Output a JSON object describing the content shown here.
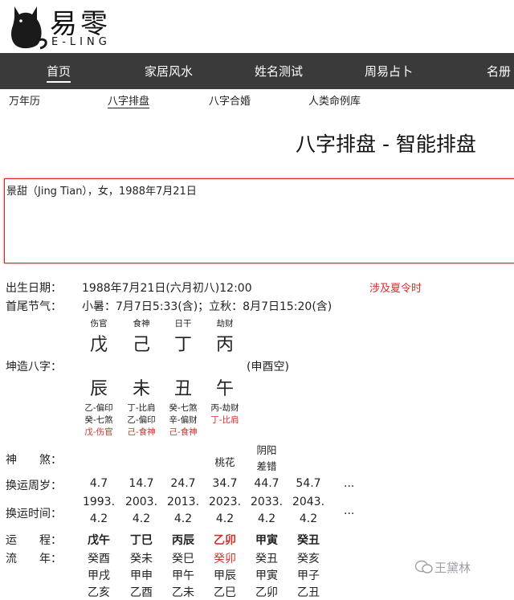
{
  "brand": {
    "name_cn": "易零",
    "name_en": "E-LING"
  },
  "nav": [
    "首页",
    "家居风水",
    "姓名测试",
    "周易占卜",
    "名册"
  ],
  "subnav": [
    "万年历",
    "八字排盘",
    "八字合婚",
    "人类命例库"
  ],
  "page_title": "八字排盘 - 智能排盘",
  "input_text": "景甜（Jing Tian），女，1988年7月21日",
  "birth": {
    "label": "出生日期：",
    "value": "1988年7月21日(六月初八)12:00",
    "note": "涉及夏令时"
  },
  "jieqi": {
    "label": "首尾节气：",
    "value": "小暑：7月7日5:33(含)；立秋：8月7日15:20(含)"
  },
  "bazi": {
    "label": "坤造八字：",
    "kongwang": "(申酉空)",
    "gods": [
      "伤官",
      "食神",
      "日干",
      "劫财"
    ],
    "stems": [
      "戊",
      "己",
      "丁",
      "丙"
    ],
    "branches": [
      "辰",
      "未",
      "丑",
      "午"
    ],
    "hidden": [
      [
        "乙-偏印",
        "癸-七煞",
        "戊-伤官"
      ],
      [
        "丁-比肩",
        "乙-偏印",
        "己-食神"
      ],
      [
        "癸-七煞",
        "辛-偏财",
        "己-食神"
      ],
      [
        "丙-劫财",
        "丁-比肩"
      ]
    ]
  },
  "shensha": {
    "label": "神　　煞：",
    "items": [
      "",
      "",
      "",
      "桃花",
      "阴阳\n差错",
      ""
    ]
  },
  "huanyun_age": {
    "label": "换运周岁：",
    "values": [
      "4.7",
      "14.7",
      "24.7",
      "34.7",
      "44.7",
      "54.7"
    ],
    "more": "..."
  },
  "huanyun_time": {
    "label": "换运时间：",
    "years": [
      "1993.",
      "2003.",
      "2013.",
      "2023.",
      "2033.",
      "2043."
    ],
    "days": [
      "4.2",
      "4.2",
      "4.2",
      "4.2",
      "4.2",
      "4.2"
    ],
    "more": "..."
  },
  "yuncheng": {
    "label": "运　　程：",
    "values": [
      "戊午",
      "丁巳",
      "丙辰",
      "乙卯",
      "甲寅",
      "癸丑"
    ],
    "highlight_index": 3
  },
  "liunian": {
    "label": "流　　年：",
    "row1": [
      "癸酉",
      "癸未",
      "癸巳",
      "癸卯",
      "癸丑",
      "癸亥"
    ],
    "row2": [
      "甲戌",
      "甲申",
      "甲午",
      "甲辰",
      "甲寅",
      "甲子"
    ],
    "row3": [
      "乙亥",
      "乙酉",
      "乙未",
      "乙巳",
      "乙卯",
      "乙丑"
    ],
    "highlight_index": 3
  },
  "watermark": "王黛林",
  "colors": {
    "nav_bg": "#3a3a3a",
    "accent_red": "#d0312d"
  }
}
